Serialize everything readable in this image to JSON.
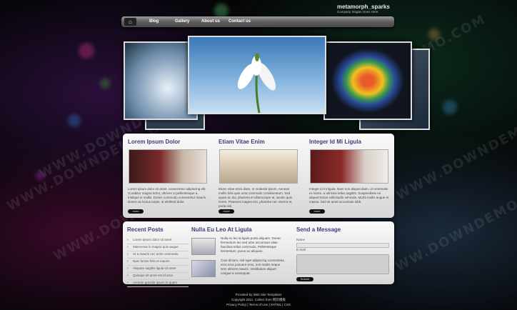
{
  "site": {
    "logo": "metamorph_sparks",
    "tagline": "Company Slogan Goes Here"
  },
  "nav": {
    "home_icon": "home-icon",
    "items": [
      "Blog",
      "Gallery",
      "About us",
      "Contact us"
    ]
  },
  "columns": [
    {
      "title": "Lorem Ipsum Dolor",
      "text": "Lorem ipsum dolor sit amet, consectetur adipiscing elit. Curabitur magna tortor, ultrices ut pellentesque a, tristique in mollis. Donec commodo consectetur mauris. Donec ac lectus turpis, ut eleifend dolor.",
      "more": "more"
    },
    {
      "title": "Etiam Vitae Enim",
      "text": "Etiam vitae enim diam, in molestie ipsum. Aenean mollis felis quis urna commodo condimentum. Sed quam ac dui, pharetra et ullamcorper at, iaculis quis lorem. Praesent magna nisi, pharetra nec viverra et, porta nisi.",
      "more": "more"
    },
    {
      "title": "Integer Id Mi Ligula",
      "text": "Integer id mi ligula. Nam non aliquet diam. Ut venenatis ex lorem, a ultricies tellus sagittis. Suspendisse mi aliquet lectus sollicitudin vehicula. Morbi mollis augue et massa. Sed sit amet accumsan nibh.",
      "more": "more"
    }
  ],
  "recent_posts": {
    "title": "Recent Posts",
    "items": [
      "Lorem ipsum dolor sit amet",
      "Maecenas in magna quis augue",
      "Ut a mauris nec enim commodo",
      "Nam luctus felis et mauris",
      "Aliquam sagittis ligula sit amet",
      "Quisque sit amet est id urna",
      "Aenean gravida ipsum in quam"
    ]
  },
  "middle": {
    "title": "Nulla Eu Leo At Ligula",
    "block1": "Nulla eu leo at ligula porta aliquam. Donec fermentum leo sed ante accumsan vitae faucibus tellus commodo. Pellentesque fermentum, purus eu aliquam.",
    "block2": "Cras dictum, nisl eget adipiscing consectetur, eros eros posuere eros, non mattis neque sem ultrices mauris. Vestibulum aliquet congue a consequat."
  },
  "contact": {
    "title": "Send a Message",
    "name_label": "Name",
    "email_label": "E-mail",
    "submit": "Submit"
  },
  "footer": {
    "line1": "Provided by Web Site Templates",
    "line2": "Copyright 2011. Collect from 网页模板",
    "line3": "Privacy Policy | Terms of Use | XHTML | CSS"
  },
  "watermark": "WWW.DOWNDEMO.COM"
}
